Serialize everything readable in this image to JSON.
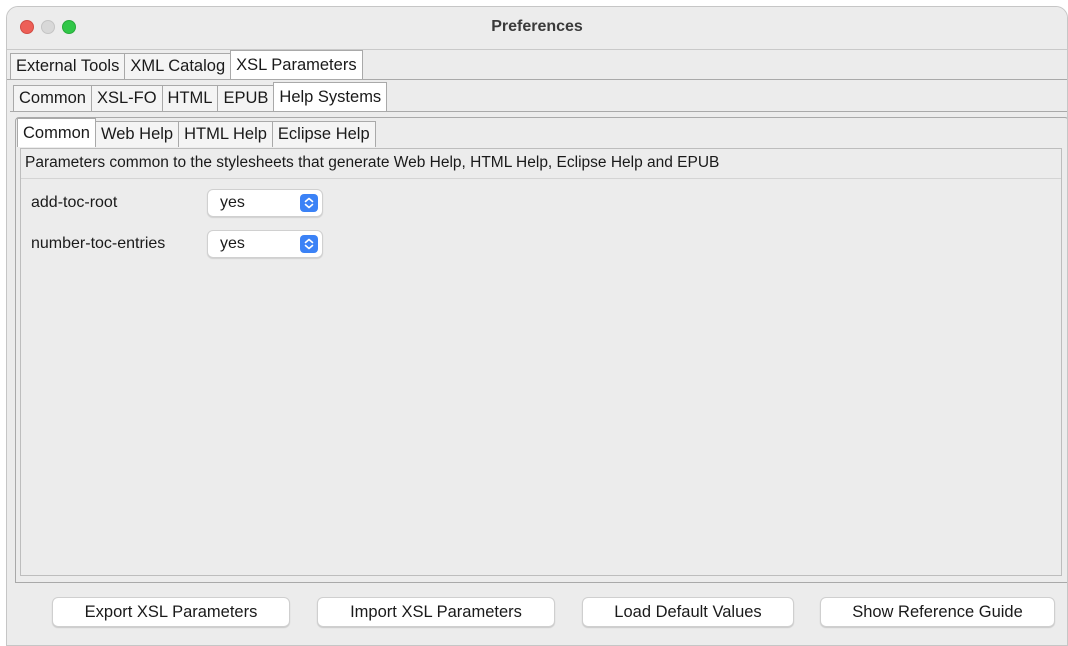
{
  "window": {
    "title": "Preferences"
  },
  "tabs_level1": [
    {
      "label": "External Tools",
      "selected": false
    },
    {
      "label": "XML Catalog",
      "selected": false
    },
    {
      "label": "XSL Parameters",
      "selected": true
    }
  ],
  "tabs_level2": [
    {
      "label": "Common",
      "selected": false
    },
    {
      "label": "XSL-FO",
      "selected": false
    },
    {
      "label": "HTML",
      "selected": false
    },
    {
      "label": "EPUB",
      "selected": false
    },
    {
      "label": "Help Systems",
      "selected": true
    }
  ],
  "tabs_level3": [
    {
      "label": "Common",
      "selected": true
    },
    {
      "label": "Web Help",
      "selected": false
    },
    {
      "label": "HTML Help",
      "selected": false
    },
    {
      "label": "Eclipse Help",
      "selected": false
    }
  ],
  "panel": {
    "description": "Parameters common to the stylesheets that generate Web Help, HTML Help, Eclipse Help and EPUB",
    "params": [
      {
        "name": "add-toc-root",
        "value": "yes"
      },
      {
        "name": "number-toc-entries",
        "value": "yes"
      }
    ]
  },
  "buttons": {
    "export": "Export XSL Parameters",
    "import": "Import XSL Parameters",
    "load_defaults": "Load Default Values",
    "reference_guide": "Show Reference Guide"
  },
  "colors": {
    "close": "#ed5f57",
    "minimize": "#d8d8d8",
    "zoom": "#31c748",
    "select_accent": "#3b82f6"
  },
  "icons": {
    "stepper": "up-down-chevron-icon"
  }
}
